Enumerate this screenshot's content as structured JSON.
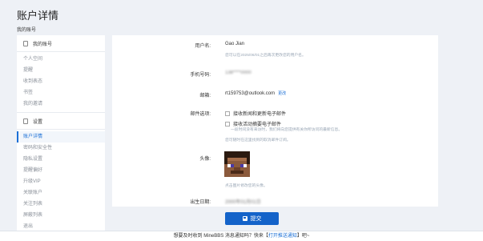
{
  "page": {
    "title": "账户详情",
    "section_title": "我的账号"
  },
  "sidebar": {
    "account_header": "我的账号",
    "account_items": [
      {
        "label": "个人空间"
      },
      {
        "label": "提醒"
      },
      {
        "label": "收到表态"
      },
      {
        "label": "书签"
      },
      {
        "label": "我的邀请"
      }
    ],
    "settings_header": "设置",
    "settings_items": [
      {
        "label": "账户详情",
        "active": true
      },
      {
        "label": "密码和安全性"
      },
      {
        "label": "隐私设置"
      },
      {
        "label": "提醒偏好"
      },
      {
        "label": "升级VIP"
      },
      {
        "label": "关联账户"
      },
      {
        "label": "关注列表"
      },
      {
        "label": "屏蔽列表"
      },
      {
        "label": "退出"
      }
    ]
  },
  "form": {
    "username_label": "用户名:",
    "username_value": "Gao Jian",
    "username_hint": "您可以在2025/06/01之后再次更改您的用户名。",
    "phone_label": "手机号码:",
    "phone_value": "138****0000",
    "email_label": "邮箱:",
    "email_value": "rt159753@outlook.com",
    "email_change": "更改",
    "email_options_label": "邮件选项:",
    "email_option_1": "接收新闻和更新电子邮件",
    "email_option_2": "接收活动摘要电子邮件",
    "email_option_2_hint": "一段时间没有来访时，我们将向您提供有关你所访问的最新信息。",
    "email_options_hint": "您可随时在这里找到的取消邮件订阅。",
    "avatar_label": "头像:",
    "avatar_hint": "点击图片修改您的头像。",
    "birthday_label": "出生日期:",
    "birthday_value": "2000年01月01日"
  },
  "actions": {
    "submit_label": "提交"
  },
  "footer": {
    "prefix": "想要及时收到 MineBBS 消息通知吗？快来【",
    "link": "打开推送通知",
    "suffix": "】吧~"
  },
  "colors": {
    "accent": "#1463c9",
    "background": "#eef1f6"
  }
}
